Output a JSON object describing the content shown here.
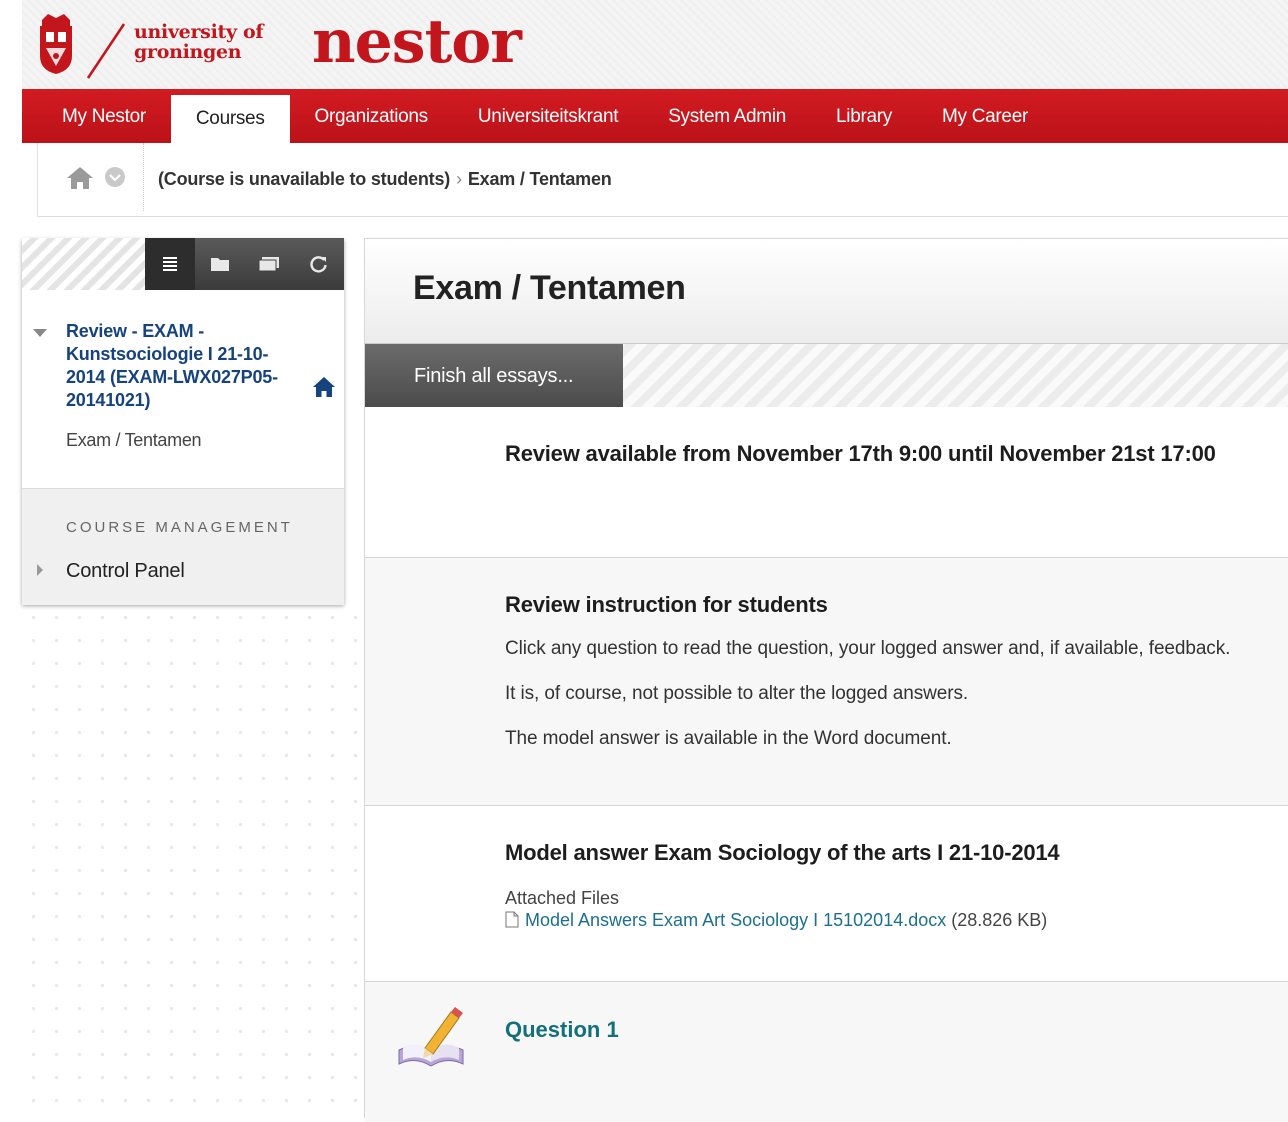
{
  "header": {
    "university_line1": "university of",
    "university_line2": "groningen",
    "brand": "nestor"
  },
  "nav": {
    "tabs": [
      {
        "label": "My Nestor"
      },
      {
        "label": "Courses"
      },
      {
        "label": "Organizations"
      },
      {
        "label": "Universiteitskrant"
      },
      {
        "label": "System Admin"
      },
      {
        "label": "Library"
      },
      {
        "label": "My Career"
      }
    ],
    "active": "Courses"
  },
  "breadcrumb": {
    "items": [
      "(Course is unavailable to students)",
      "Exam / Tentamen"
    ],
    "separator": "›"
  },
  "sidebar": {
    "course_title": "Review - EXAM - Kunstsociologie I 21-10-2014 (EXAM-LWX027P05-20141021)",
    "current_item": "Exam / Tentamen",
    "management_heading": "COURSE MANAGEMENT",
    "control_panel": "Control Panel"
  },
  "main": {
    "title": "Exam / Tentamen",
    "action_button": "Finish all essays...",
    "availability": "Review available from November 17th 9:00 until November 21st 17:00",
    "instructions": {
      "heading": "Review instruction for students",
      "lines": [
        "Click any question to read the question, your logged answer and, if available, feedback.",
        "It is, of course, not possible to alter the logged answers.",
        "The model answer is available in the Word document."
      ]
    },
    "model_answer": {
      "heading": "Model answer Exam Sociology of the arts I 21-10-2014",
      "attached_label": "Attached Files",
      "file_name": "Model Answers Exam Art Sociology I 15102014.docx",
      "file_size": "(28.826 KB)"
    },
    "question": {
      "label": "Question 1"
    }
  },
  "colors": {
    "brand_red": "#c8161d",
    "link_blue": "#16437e",
    "question_teal": "#13707a"
  }
}
